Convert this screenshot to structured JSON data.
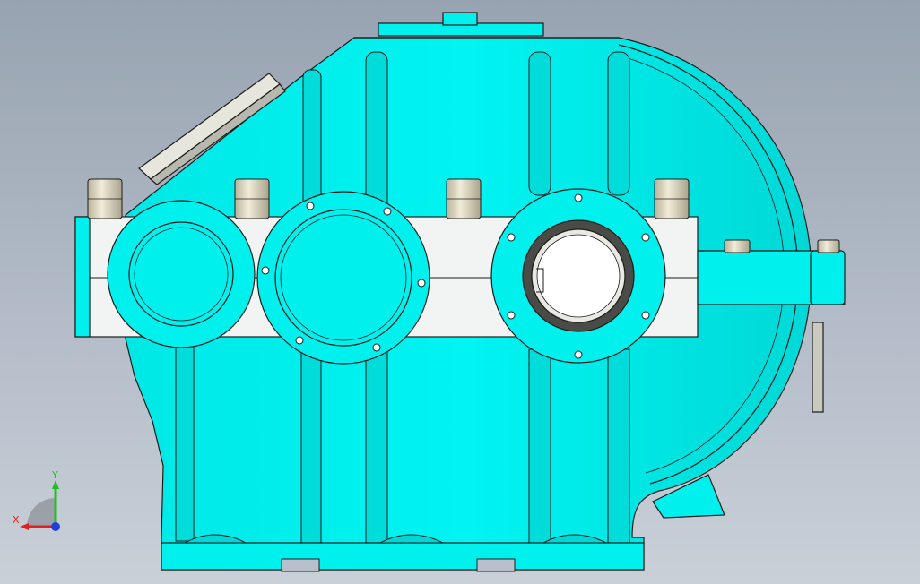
{
  "viewport": {
    "part_color": "#00f0ee",
    "part_shade": "#00c9c7",
    "flange_color": "#f2f3f3",
    "edge_color": "#1b1b1b",
    "background_top": "#98a3b1",
    "background_bottom": "#c9d0d8"
  },
  "triad": {
    "x_label": "X",
    "y_label": "Y",
    "x_color": "#e02020",
    "y_color": "#20c020",
    "z_color": "#1f3fd8"
  },
  "icons": {
    "triad": "coordinate-triad-icon"
  }
}
